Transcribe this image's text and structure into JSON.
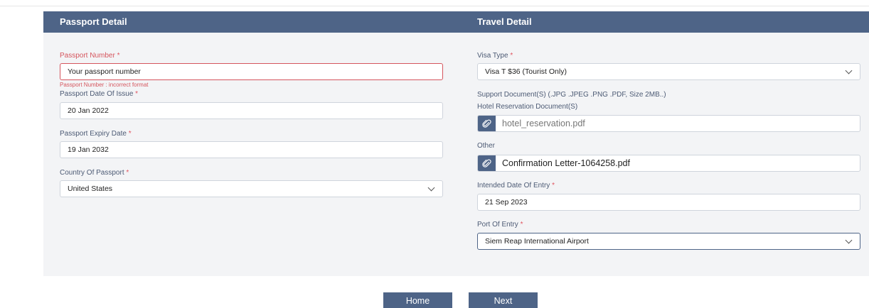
{
  "passport": {
    "header": "Passport Detail",
    "number_label": "Passport Number",
    "number_value": "Your passport number",
    "number_error": "Passport Number : incorrect format",
    "issue_label": "Passport Date Of Issue",
    "issue_value": "20 Jan 2022",
    "expiry_label": "Passport Expiry Date",
    "expiry_value": "19 Jan 2032",
    "country_label": "Country Of Passport",
    "country_value": "United States",
    "required_mark": "*"
  },
  "travel": {
    "header": "Travel Detail",
    "visa_label": "Visa Type",
    "visa_value": "Visa T $36 (Tourist Only)",
    "support_label": "Support Document(S) (.JPG .JPEG .PNG .PDF, Size 2MB..)",
    "hotel_label": "Hotel Reservation Document(S)",
    "hotel_file": "hotel_reservation.pdf",
    "other_label": "Other",
    "other_file": "Confirmation Letter-1064258.pdf",
    "entry_date_label": "Intended Date Of Entry",
    "entry_date_value": "21 Sep 2023",
    "port_label": "Port Of Entry",
    "port_value": "Siem Reap International Airport",
    "required_mark": "*"
  },
  "buttons": {
    "home": "Home",
    "next": "Next"
  },
  "colors": {
    "header_bg": "#4e6487",
    "panel_bg": "#f3f4f6",
    "error": "#d5555d",
    "required": "#e05560"
  }
}
